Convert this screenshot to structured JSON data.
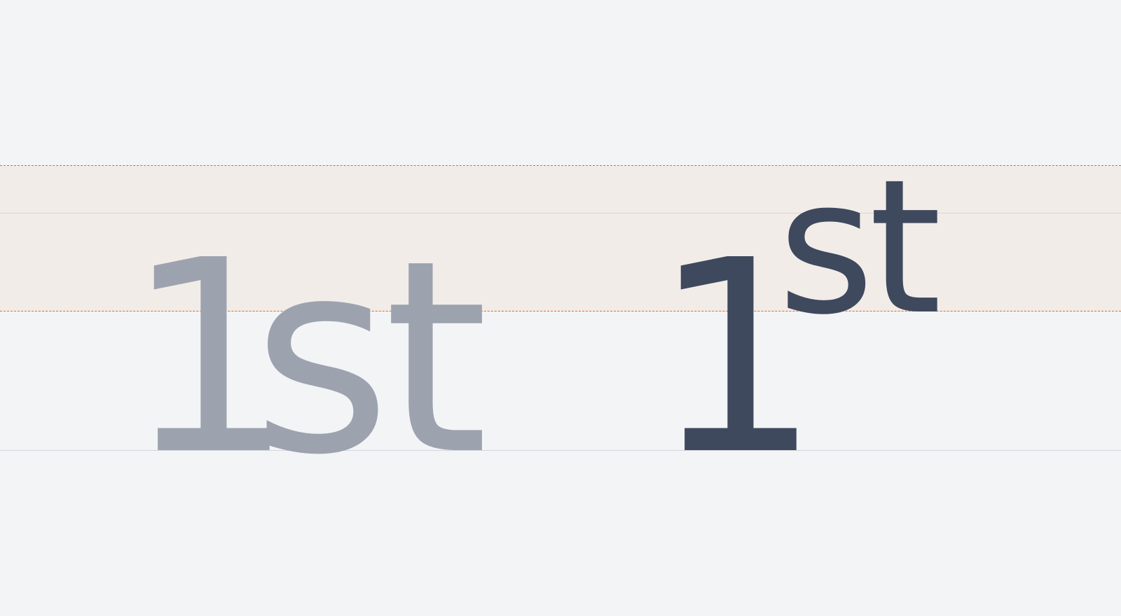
{
  "colors": {
    "background": "#f3f4f6",
    "superscript_band": "#f2ece8",
    "guide_dashed": "#d97020",
    "guide_solid": "#d4d5da",
    "ligature_text": "#9ca3af",
    "ordinal_text": "#3e495d"
  },
  "sample_plain": {
    "numeral": "1",
    "suffix": "st"
  },
  "sample_ordinal": {
    "numeral": "1",
    "suffix": "st"
  }
}
